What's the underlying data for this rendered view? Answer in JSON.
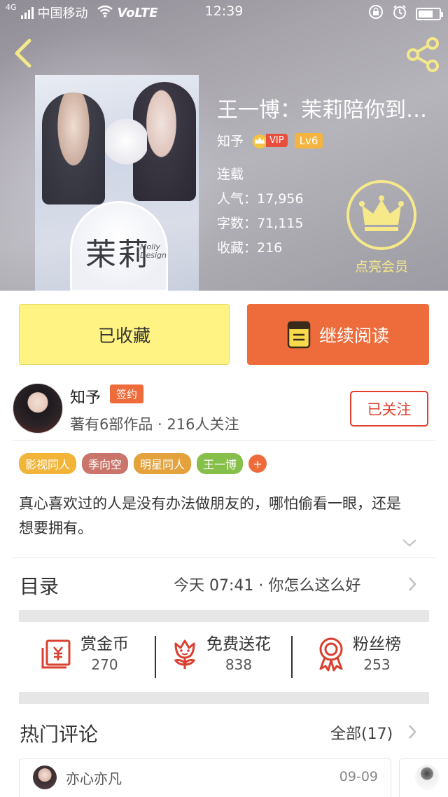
{
  "status_bar": {
    "network_gen": "4G",
    "carrier": "中国移动",
    "volte": "VoLTE",
    "time": "12:39",
    "battery_level": 0.75
  },
  "book": {
    "title": "王一博：茉莉陪你到…",
    "author": "知予",
    "vip_label": "VIP",
    "level": "Lv6",
    "status": "连载",
    "popularity": "人气：17,956",
    "word_count": "字数：71,115",
    "favorites": "收藏：216",
    "member_label": "点亮会员",
    "cover_title_art": "茉莉",
    "cover_brand": "Molly\nDesign"
  },
  "actions": {
    "favorited_label": "已收藏",
    "continue_label": "继续阅读"
  },
  "author_info": {
    "name": "知予",
    "signed_tag": "签约",
    "stats": "著有6部作品 · 216人关注",
    "follow_label": "已关注"
  },
  "tags": [
    {
      "label": "影视同人",
      "color": "#f2b53a"
    },
    {
      "label": "季向空",
      "color": "#c9756b"
    },
    {
      "label": "明星同人",
      "color": "#e3a23b"
    },
    {
      "label": "王一博",
      "color": "#86bf4a"
    }
  ],
  "tag_more": "+",
  "intro": "真心喜欢过的人是没有办法做朋友的，哪怕偷看一眼，还是想要拥有。",
  "catalog": {
    "title": "目录",
    "latest": "今天 07:41 · 你怎么这么好"
  },
  "rewards": [
    {
      "label": "赏金币",
      "count": "270",
      "icon": "red-envelope-icon"
    },
    {
      "label": "免费送花",
      "count": "838",
      "icon": "flower-icon"
    },
    {
      "label": "粉丝榜",
      "count": "253",
      "icon": "medal-icon"
    }
  ],
  "comments": {
    "title": "热门评论",
    "all_label": "全部(17)",
    "items": [
      {
        "user": "亦心亦凡",
        "date": "09-09"
      }
    ]
  },
  "colors": {
    "accent": "#ee6b3b",
    "favorite_button": "#fff383",
    "member_gold": "#f5e98a",
    "follow_red": "#e0412f",
    "icon_red": "#d9402f"
  }
}
